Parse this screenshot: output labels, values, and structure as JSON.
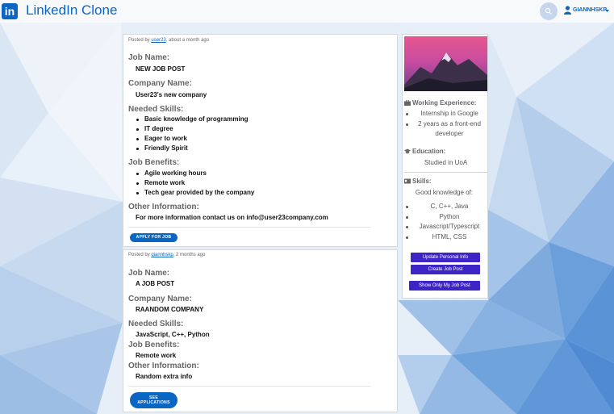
{
  "nav": {
    "logo_text": "in",
    "brand": "LinkedIn Clone",
    "username": "GIANNHSKP"
  },
  "posts": [
    {
      "posted_prefix": "Posted by ",
      "author": "user23",
      "time": ", about a month ago",
      "job_name_label": "Job Name:",
      "job_name": "NEW JOB POST",
      "company_label": "Company Name:",
      "company": "User23's new company",
      "skills_label": "Needed Skills:",
      "skills": [
        "Basic knowledge of programming",
        "IT degree",
        "Eager to work",
        "Friendly Spirit"
      ],
      "benefits_label": "Job Benefits:",
      "benefits": [
        "Agile working hours",
        "Remote work",
        "Tech gear provided by the company"
      ],
      "other_label": "Other Information:",
      "other": "For more information contact us on info@user23company.com",
      "button": "APPLY FOR JOB"
    },
    {
      "posted_prefix": "Posted by ",
      "author": "giannhskp",
      "time": ", 2 months ago",
      "job_name_label": "Job Name:",
      "job_name": "A JOB POST",
      "company_label": "Company Name:",
      "company": "RAANDOM COMPANY",
      "skills_label": "Needed Skills:",
      "skills_text": "JavaScript, C++, Python",
      "benefits_label": "Job Benefits:",
      "benefits_text": "Remote work",
      "other_label": "Other Information:",
      "other": "Random extra info",
      "button_line1": "SEE",
      "button_line2": "APPLICATIONS"
    }
  ],
  "profile": {
    "experience_label": "Working Experience:",
    "experience": [
      "Internship in Google",
      "2 years as a front-end",
      "developer"
    ],
    "education_label": "Education:",
    "education": "Studied in UoA",
    "skills_label": "Skills:",
    "skills_intro": "Good knowledge of:",
    "skills": [
      "C, C++, Java",
      "Python",
      "Javascript/Typescript",
      "HTML, CSS"
    ],
    "buttons": [
      "Update Personal Info",
      "Create Job Post",
      "Show Only My Job Post"
    ]
  },
  "colors": {
    "brand_blue": "#0a66c2",
    "action_purple": "#3d24c6"
  }
}
